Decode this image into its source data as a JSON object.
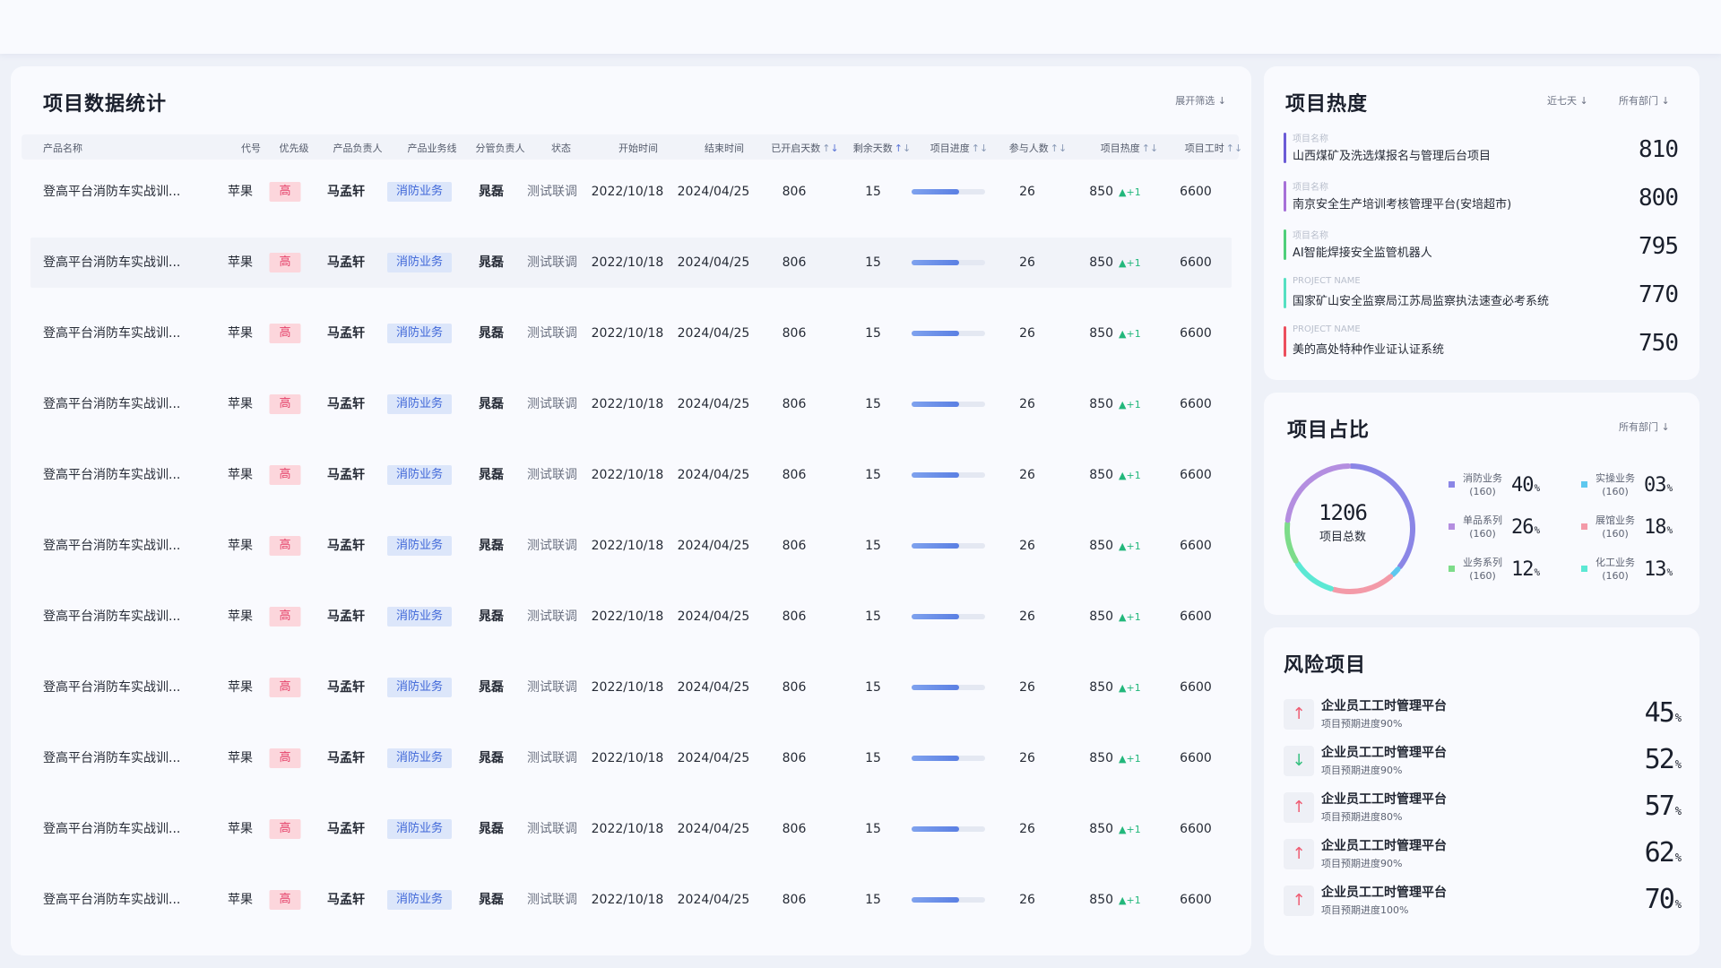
{
  "table_card": {
    "title": "项目数据统计",
    "filter": "展开筛选",
    "columns": [
      "产品名称",
      "代号",
      "优先级",
      "产品负责人",
      "产品业务线",
      "分管负责人",
      "状态",
      "开始时间",
      "结束时间",
      "已开启天数",
      "剩余天数",
      "项目进度",
      "参与人数",
      "项目热度",
      "项目工时"
    ],
    "rows": [
      {
        "name": "登高平台消防车实战训...",
        "code": "苹果",
        "priority": "高",
        "owner": "马孟轩",
        "biz": "消防业务",
        "manager": "晁磊",
        "status": "测试联调",
        "start": "2022/10/18",
        "end": "2024/04/25",
        "opened": "806",
        "remain": "15",
        "progress": 0.65,
        "people": "26",
        "heat": "850",
        "heat_delta": "▲+1",
        "hours": "6600"
      },
      {
        "name": "登高平台消防车实战训...",
        "code": "苹果",
        "priority": "高",
        "owner": "马孟轩",
        "biz": "消防业务",
        "manager": "晁磊",
        "status": "测试联调",
        "start": "2022/10/18",
        "end": "2024/04/25",
        "opened": "806",
        "remain": "15",
        "progress": 0.65,
        "people": "26",
        "heat": "850",
        "heat_delta": "▲+1",
        "hours": "6600"
      },
      {
        "name": "登高平台消防车实战训...",
        "code": "苹果",
        "priority": "高",
        "owner": "马孟轩",
        "biz": "消防业务",
        "manager": "晁磊",
        "status": "测试联调",
        "start": "2022/10/18",
        "end": "2024/04/25",
        "opened": "806",
        "remain": "15",
        "progress": 0.65,
        "people": "26",
        "heat": "850",
        "heat_delta": "▲+1",
        "hours": "6600"
      },
      {
        "name": "登高平台消防车实战训...",
        "code": "苹果",
        "priority": "高",
        "owner": "马孟轩",
        "biz": "消防业务",
        "manager": "晁磊",
        "status": "测试联调",
        "start": "2022/10/18",
        "end": "2024/04/25",
        "opened": "806",
        "remain": "15",
        "progress": 0.65,
        "people": "26",
        "heat": "850",
        "heat_delta": "▲+1",
        "hours": "6600"
      },
      {
        "name": "登高平台消防车实战训...",
        "code": "苹果",
        "priority": "高",
        "owner": "马孟轩",
        "biz": "消防业务",
        "manager": "晁磊",
        "status": "测试联调",
        "start": "2022/10/18",
        "end": "2024/04/25",
        "opened": "806",
        "remain": "15",
        "progress": 0.65,
        "people": "26",
        "heat": "850",
        "heat_delta": "▲+1",
        "hours": "6600"
      },
      {
        "name": "登高平台消防车实战训...",
        "code": "苹果",
        "priority": "高",
        "owner": "马孟轩",
        "biz": "消防业务",
        "manager": "晁磊",
        "status": "测试联调",
        "start": "2022/10/18",
        "end": "2024/04/25",
        "opened": "806",
        "remain": "15",
        "progress": 0.65,
        "people": "26",
        "heat": "850",
        "heat_delta": "▲+1",
        "hours": "6600"
      },
      {
        "name": "登高平台消防车实战训...",
        "code": "苹果",
        "priority": "高",
        "owner": "马孟轩",
        "biz": "消防业务",
        "manager": "晁磊",
        "status": "测试联调",
        "start": "2022/10/18",
        "end": "2024/04/25",
        "opened": "806",
        "remain": "15",
        "progress": 0.65,
        "people": "26",
        "heat": "850",
        "heat_delta": "▲+1",
        "hours": "6600"
      },
      {
        "name": "登高平台消防车实战训...",
        "code": "苹果",
        "priority": "高",
        "owner": "马孟轩",
        "biz": "消防业务",
        "manager": "晁磊",
        "status": "测试联调",
        "start": "2022/10/18",
        "end": "2024/04/25",
        "opened": "806",
        "remain": "15",
        "progress": 0.65,
        "people": "26",
        "heat": "850",
        "heat_delta": "▲+1",
        "hours": "6600"
      },
      {
        "name": "登高平台消防车实战训...",
        "code": "苹果",
        "priority": "高",
        "owner": "马孟轩",
        "biz": "消防业务",
        "manager": "晁磊",
        "status": "测试联调",
        "start": "2022/10/18",
        "end": "2024/04/25",
        "opened": "806",
        "remain": "15",
        "progress": 0.65,
        "people": "26",
        "heat": "850",
        "heat_delta": "▲+1",
        "hours": "6600"
      },
      {
        "name": "登高平台消防车实战训...",
        "code": "苹果",
        "priority": "高",
        "owner": "马孟轩",
        "biz": "消防业务",
        "manager": "晁磊",
        "status": "测试联调",
        "start": "2022/10/18",
        "end": "2024/04/25",
        "opened": "806",
        "remain": "15",
        "progress": 0.65,
        "people": "26",
        "heat": "850",
        "heat_delta": "▲+1",
        "hours": "6600"
      },
      {
        "name": "登高平台消防车实战训...",
        "code": "苹果",
        "priority": "高",
        "owner": "马孟轩",
        "biz": "消防业务",
        "manager": "晁磊",
        "status": "测试联调",
        "start": "2022/10/18",
        "end": "2024/04/25",
        "opened": "806",
        "remain": "15",
        "progress": 0.65,
        "people": "26",
        "heat": "850",
        "heat_delta": "▲+1",
        "hours": "6600"
      }
    ]
  },
  "heat_card": {
    "title": "项目热度",
    "filter_time": "近七天",
    "filter_dept": "所有部门",
    "items": [
      {
        "label": "项目名称",
        "name": "山西煤矿及洗选煤报名与管理后台项目",
        "value": "810",
        "color": "#6b5bd6"
      },
      {
        "label": "项目名称",
        "name": "南京安全生产培训考核管理平台(安培超市)",
        "value": "800",
        "color": "#a670d8"
      },
      {
        "label": "项目名称",
        "name": "AI智能焊接安全监管机器人",
        "value": "795",
        "color": "#4fcf7a"
      },
      {
        "label": "PROJECT NAME",
        "name": "国家矿山安全监察局江苏局监察执法速查必考系统",
        "value": "770",
        "color": "#56e0c2"
      },
      {
        "label": "PROJECT NAME",
        "name": "美的高处特种作业证认证系统",
        "value": "750",
        "color": "#ec4f5e"
      }
    ]
  },
  "share_card": {
    "title": "项目占比",
    "filter_dept": "所有部门",
    "total": "1206",
    "total_label": "项目总数",
    "chart_data": {
      "type": "pie",
      "categories": [
        "消防业务",
        "实操业务",
        "单品系列",
        "展馆业务",
        "业务系列",
        "化工业务"
      ],
      "values": [
        40,
        3,
        26,
        18,
        12,
        13
      ],
      "counts": [
        "(160)",
        "(160)",
        "(160)",
        "(160)",
        "(160)",
        "(160)"
      ],
      "labels": [
        "40",
        "03",
        "26",
        "18",
        "12",
        "13"
      ],
      "colors": [
        "#8b86e6",
        "#5ec8ef",
        "#b48ee0",
        "#f39aa8",
        "#7ddc8a",
        "#5ce8d4"
      ]
    }
  },
  "risk_card": {
    "title": "风险项目",
    "items": [
      {
        "name": "企业员工工时管理平台",
        "sub": "项目预期进度90%",
        "pct": "45",
        "dir": "up"
      },
      {
        "name": "企业员工工时管理平台",
        "sub": "项目预期进度90%",
        "pct": "52",
        "dir": "down"
      },
      {
        "name": "企业员工工时管理平台",
        "sub": "项目预期进度80%",
        "pct": "57",
        "dir": "up"
      },
      {
        "name": "企业员工工时管理平台",
        "sub": "项目预期进度90%",
        "pct": "62",
        "dir": "up"
      },
      {
        "name": "企业员工工时管理平台",
        "sub": "项目预期进度100%",
        "pct": "70",
        "dir": "up"
      }
    ]
  }
}
